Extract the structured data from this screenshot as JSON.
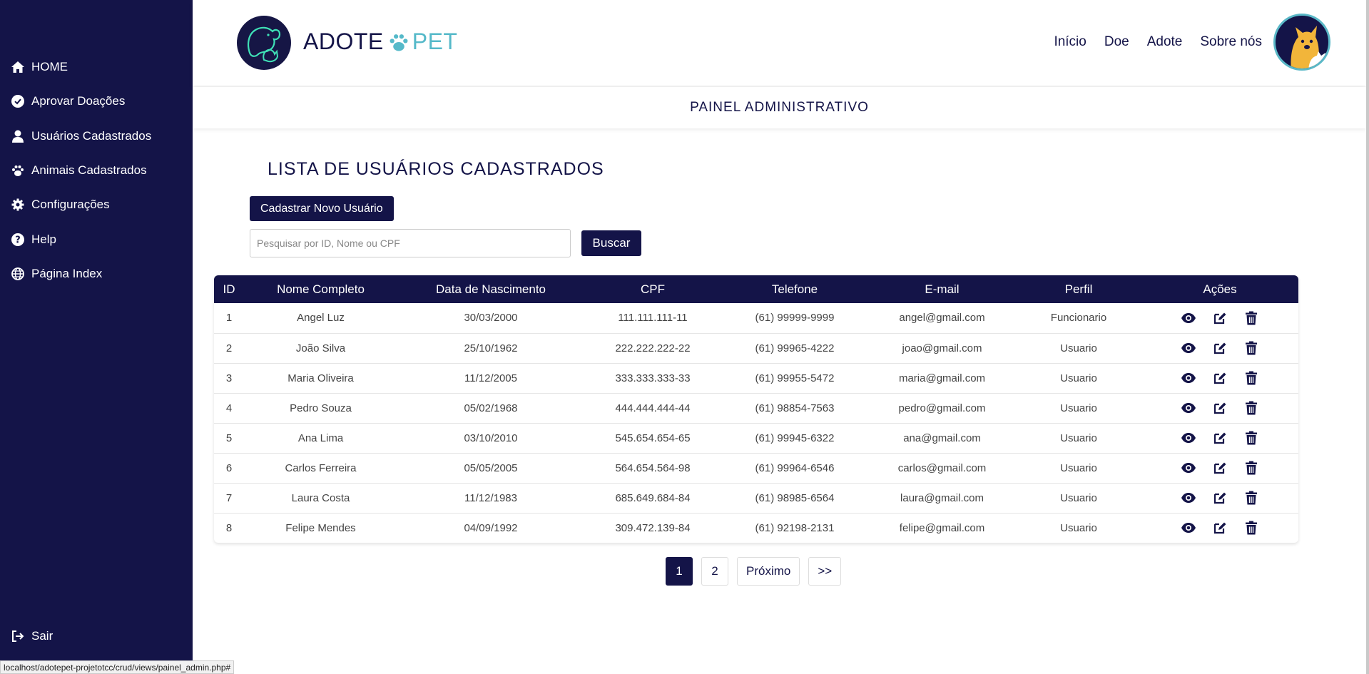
{
  "sidebar": {
    "items": [
      {
        "label": "HOME",
        "icon": "home-icon"
      },
      {
        "label": "Aprovar Doações",
        "icon": "check-circle-icon"
      },
      {
        "label": "Usuários Cadastrados",
        "icon": "user-icon"
      },
      {
        "label": "Animais Cadastrados",
        "icon": "paw-icon"
      },
      {
        "label": "Configurações",
        "icon": "gear-icon"
      },
      {
        "label": "Help",
        "icon": "help-icon"
      },
      {
        "label": "Página Index",
        "icon": "globe-icon"
      }
    ],
    "logout": {
      "label": "Sair",
      "icon": "logout-icon"
    }
  },
  "header": {
    "brand_a": "ADOTE",
    "brand_p": "PET",
    "nav": [
      "Início",
      "Doe",
      "Adote",
      "Sobre nós"
    ]
  },
  "subheader": {
    "title": "PAINEL ADMINISTRATIVO"
  },
  "main": {
    "title": "LISTA DE USUÁRIOS CADASTRADOS",
    "new_button": "Cadastrar Novo Usuário",
    "search_placeholder": "Pesquisar por ID, Nome ou CPF",
    "search_button": "Buscar"
  },
  "table": {
    "columns": [
      "ID",
      "Nome Completo",
      "Data de Nascimento",
      "CPF",
      "Telefone",
      "E-mail",
      "Perfil",
      "Ações"
    ],
    "rows": [
      [
        "1",
        "Angel Luz",
        "30/03/2000",
        "111.111.111-11",
        "(61) 99999-9999",
        "angel@gmail.com",
        "Funcionario"
      ],
      [
        "2",
        "João Silva",
        "25/10/1962",
        "222.222.222-22",
        "(61) 99965-4222",
        "joao@gmail.com",
        "Usuario"
      ],
      [
        "3",
        "Maria Oliveira",
        "11/12/2005",
        "333.333.333-33",
        "(61) 99955-5472",
        "maria@gmail.com",
        "Usuario"
      ],
      [
        "4",
        "Pedro Souza",
        "05/02/1968",
        "444.444.444-44",
        "(61) 98854-7563",
        "pedro@gmail.com",
        "Usuario"
      ],
      [
        "5",
        "Ana Lima",
        "03/10/2010",
        "545.654.654-65",
        "(61) 99945-6322",
        "ana@gmail.com",
        "Usuario"
      ],
      [
        "6",
        "Carlos Ferreira",
        "05/05/2005",
        "564.654.564-98",
        "(61) 99964-6546",
        "carlos@gmail.com",
        "Usuario"
      ],
      [
        "7",
        "Laura Costa",
        "11/12/1983",
        "685.649.684-84",
        "(61) 98985-6564",
        "laura@gmail.com",
        "Usuario"
      ],
      [
        "8",
        "Felipe Mendes",
        "04/09/1992",
        "309.472.139-84",
        "(61) 92198-2131",
        "felipe@gmail.com",
        "Usuario"
      ]
    ]
  },
  "pagination": {
    "pages": [
      "1",
      "2"
    ],
    "next": "Próximo",
    "last": ">>",
    "current": "1"
  },
  "status_url": "localhost/adotepet-projetotcc/crud/views/painel_admin.php#",
  "colors": {
    "primary": "#141448",
    "accent": "#55b9c9"
  }
}
